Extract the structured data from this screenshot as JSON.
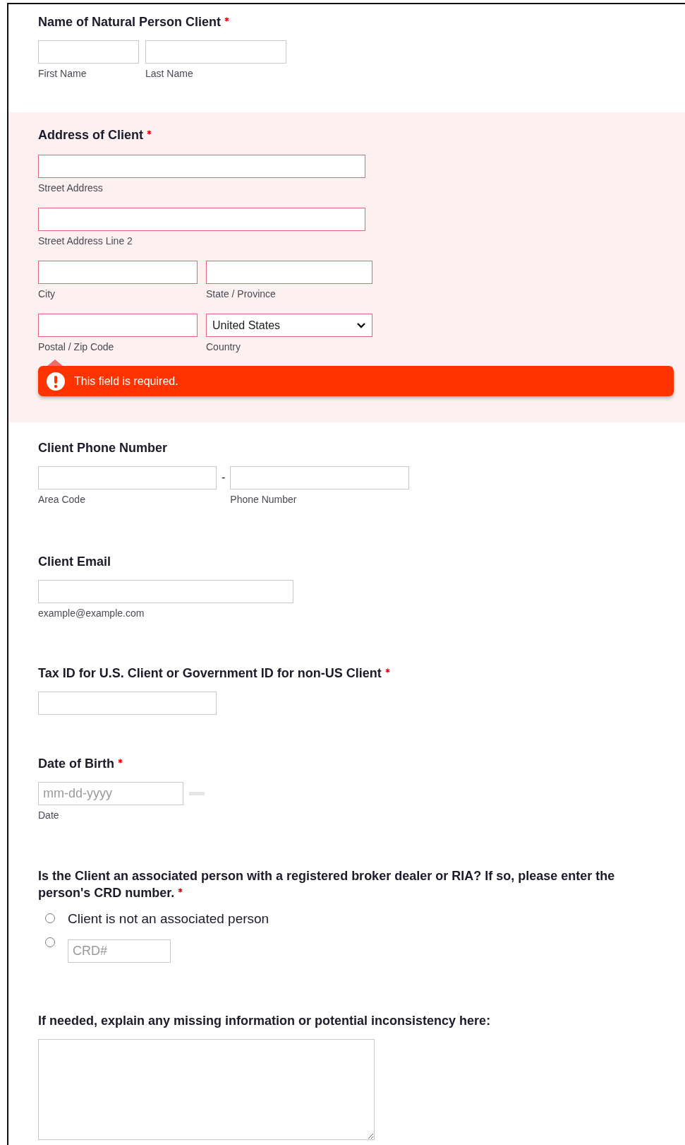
{
  "sections": [
    {
      "kind": "name",
      "label": "Name of Natural Person Client",
      "required": true,
      "error": false,
      "fields": [
        {
          "kind": "input",
          "sublabel": "First Name"
        },
        {
          "kind": "input",
          "sublabel": "Last Name"
        }
      ]
    },
    {
      "kind": "address",
      "label": "Address of Client",
      "required": true,
      "error": true,
      "error_message": "This field is required.",
      "rows": [
        [
          {
            "kind": "input",
            "sublabel": "Street Address"
          }
        ],
        [
          {
            "kind": "input",
            "sublabel": "Street Address Line 2"
          }
        ],
        [
          {
            "kind": "input",
            "sublabel": "City"
          },
          {
            "kind": "input",
            "sublabel": "State / Province"
          }
        ],
        [
          {
            "kind": "input",
            "sublabel": "Postal / Zip Code"
          },
          {
            "kind": "select",
            "value": "United States",
            "sublabel": "Country"
          }
        ]
      ]
    },
    {
      "kind": "phone",
      "label": "Client Phone Number",
      "required": false,
      "error": false,
      "separator": "-",
      "fields": [
        {
          "kind": "input",
          "sublabel": "Area Code"
        },
        {
          "kind": "input",
          "sublabel": "Phone Number"
        }
      ]
    },
    {
      "kind": "email",
      "label": "Client Email",
      "required": false,
      "error": false,
      "fields": [
        {
          "kind": "input",
          "sublabel": "example@example.com"
        }
      ]
    },
    {
      "kind": "text",
      "label": "Tax ID for U.S. Client or Government ID for non-US Client",
      "required": true,
      "error": false,
      "fields": [
        {
          "kind": "input"
        }
      ]
    },
    {
      "kind": "date",
      "label": "Date of Birth",
      "required": true,
      "error": false,
      "fields": [
        {
          "kind": "date",
          "placeholder": "mm-dd-yyyy",
          "sublabel": "Date"
        }
      ]
    },
    {
      "kind": "choice",
      "label": "Is the Client an associated person with a registered broker dealer or RIA? If so, please enter the person's CRD number.",
      "required": true,
      "error": false,
      "options": [
        {
          "kind": "text",
          "label": "Client is not an associated person",
          "selected": false
        },
        {
          "kind": "input",
          "placeholder": "CRD#",
          "selected": false
        }
      ]
    },
    {
      "kind": "textarea",
      "label": "If needed, explain any missing information or potential inconsistency here:",
      "required": false,
      "error": false
    }
  ]
}
